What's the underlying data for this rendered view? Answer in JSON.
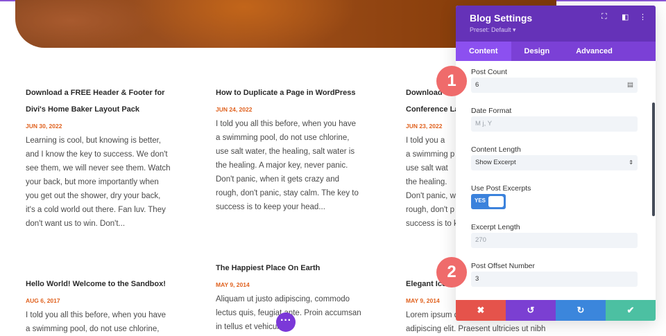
{
  "posts": [
    {
      "title": "Download a FREE Header & Footer for Divi's Home Baker Layout Pack",
      "date": "JUN 30, 2022",
      "excerpt": "Learning is cool, but knowing is better, and I know the key to success. We don't see them, we will never see them. Watch your back, but more importantly when you get out the shower, dry your back, it's a cold world out there. Fan luv. They don't want us to win. Don't..."
    },
    {
      "title": "How to Duplicate a Page in WordPress",
      "date": "JUN 24, 2022",
      "excerpt": "I told you all this before, when you have a swimming pool, do not use chlorine, use salt water, the healing, salt water is the healing. A major key, never panic. Don't panic, when it gets crazy and rough, don't panic, stay calm. The key to success is to keep your head..."
    },
    {
      "title_lines": [
        "Download",
        "Conference La"
      ],
      "date": "JUN 23, 2022",
      "excerpt_lines": [
        "I told you a",
        "a swimming p",
        "use salt wat",
        "the healing.",
        "Don't panic, wh",
        "rough, don't p",
        "success is to k"
      ]
    },
    {
      "title": "Hello World! Welcome to the Sandbox!",
      "date": "AUG 6, 2017",
      "excerpt": "I told you all this before, when you have a swimming pool, do not use chlorine,"
    },
    {
      "title": "The Happiest Place On Earth",
      "date": "MAY 9, 2014",
      "excerpt": "Aliquam ut justo adipiscing, commodo lectus quis, feugiat ante. Proin accumsan in tellus et vehicula."
    },
    {
      "title": "Elegant Ico",
      "date": "MAY 9, 2014",
      "excerpt_lines": [
        "Lorem ipsum d",
        "adipiscing elit. Praesent ultricies ut nibh"
      ]
    }
  ],
  "panel": {
    "title": "Blog Settings",
    "preset": "Preset: Default ▾",
    "tabs": [
      "Content",
      "Design",
      "Advanced"
    ],
    "fields": {
      "post_count": {
        "label": "Post Count",
        "value": "6"
      },
      "date_format": {
        "label": "Date Format",
        "placeholder": "M j, Y"
      },
      "content_length": {
        "label": "Content Length",
        "value": "Show Excerpt"
      },
      "use_excerpts": {
        "label": "Use Post Excerpts",
        "value": "YES"
      },
      "excerpt_length": {
        "label": "Excerpt Length",
        "placeholder": "270"
      },
      "post_offset": {
        "label": "Post Offset Number",
        "value": "3"
      }
    },
    "buttons": {
      "cancel": "✖",
      "undo": "↺",
      "redo": "↻",
      "save": "✔"
    }
  },
  "badges": [
    "1",
    "2"
  ],
  "fab": "···",
  "colors": {
    "purple": "#6532b8",
    "cancel": "#e5534b",
    "undo": "#7b3fd2",
    "redo": "#3b86dc",
    "save": "#4cc0a2",
    "badge": "#ef6b6b"
  }
}
